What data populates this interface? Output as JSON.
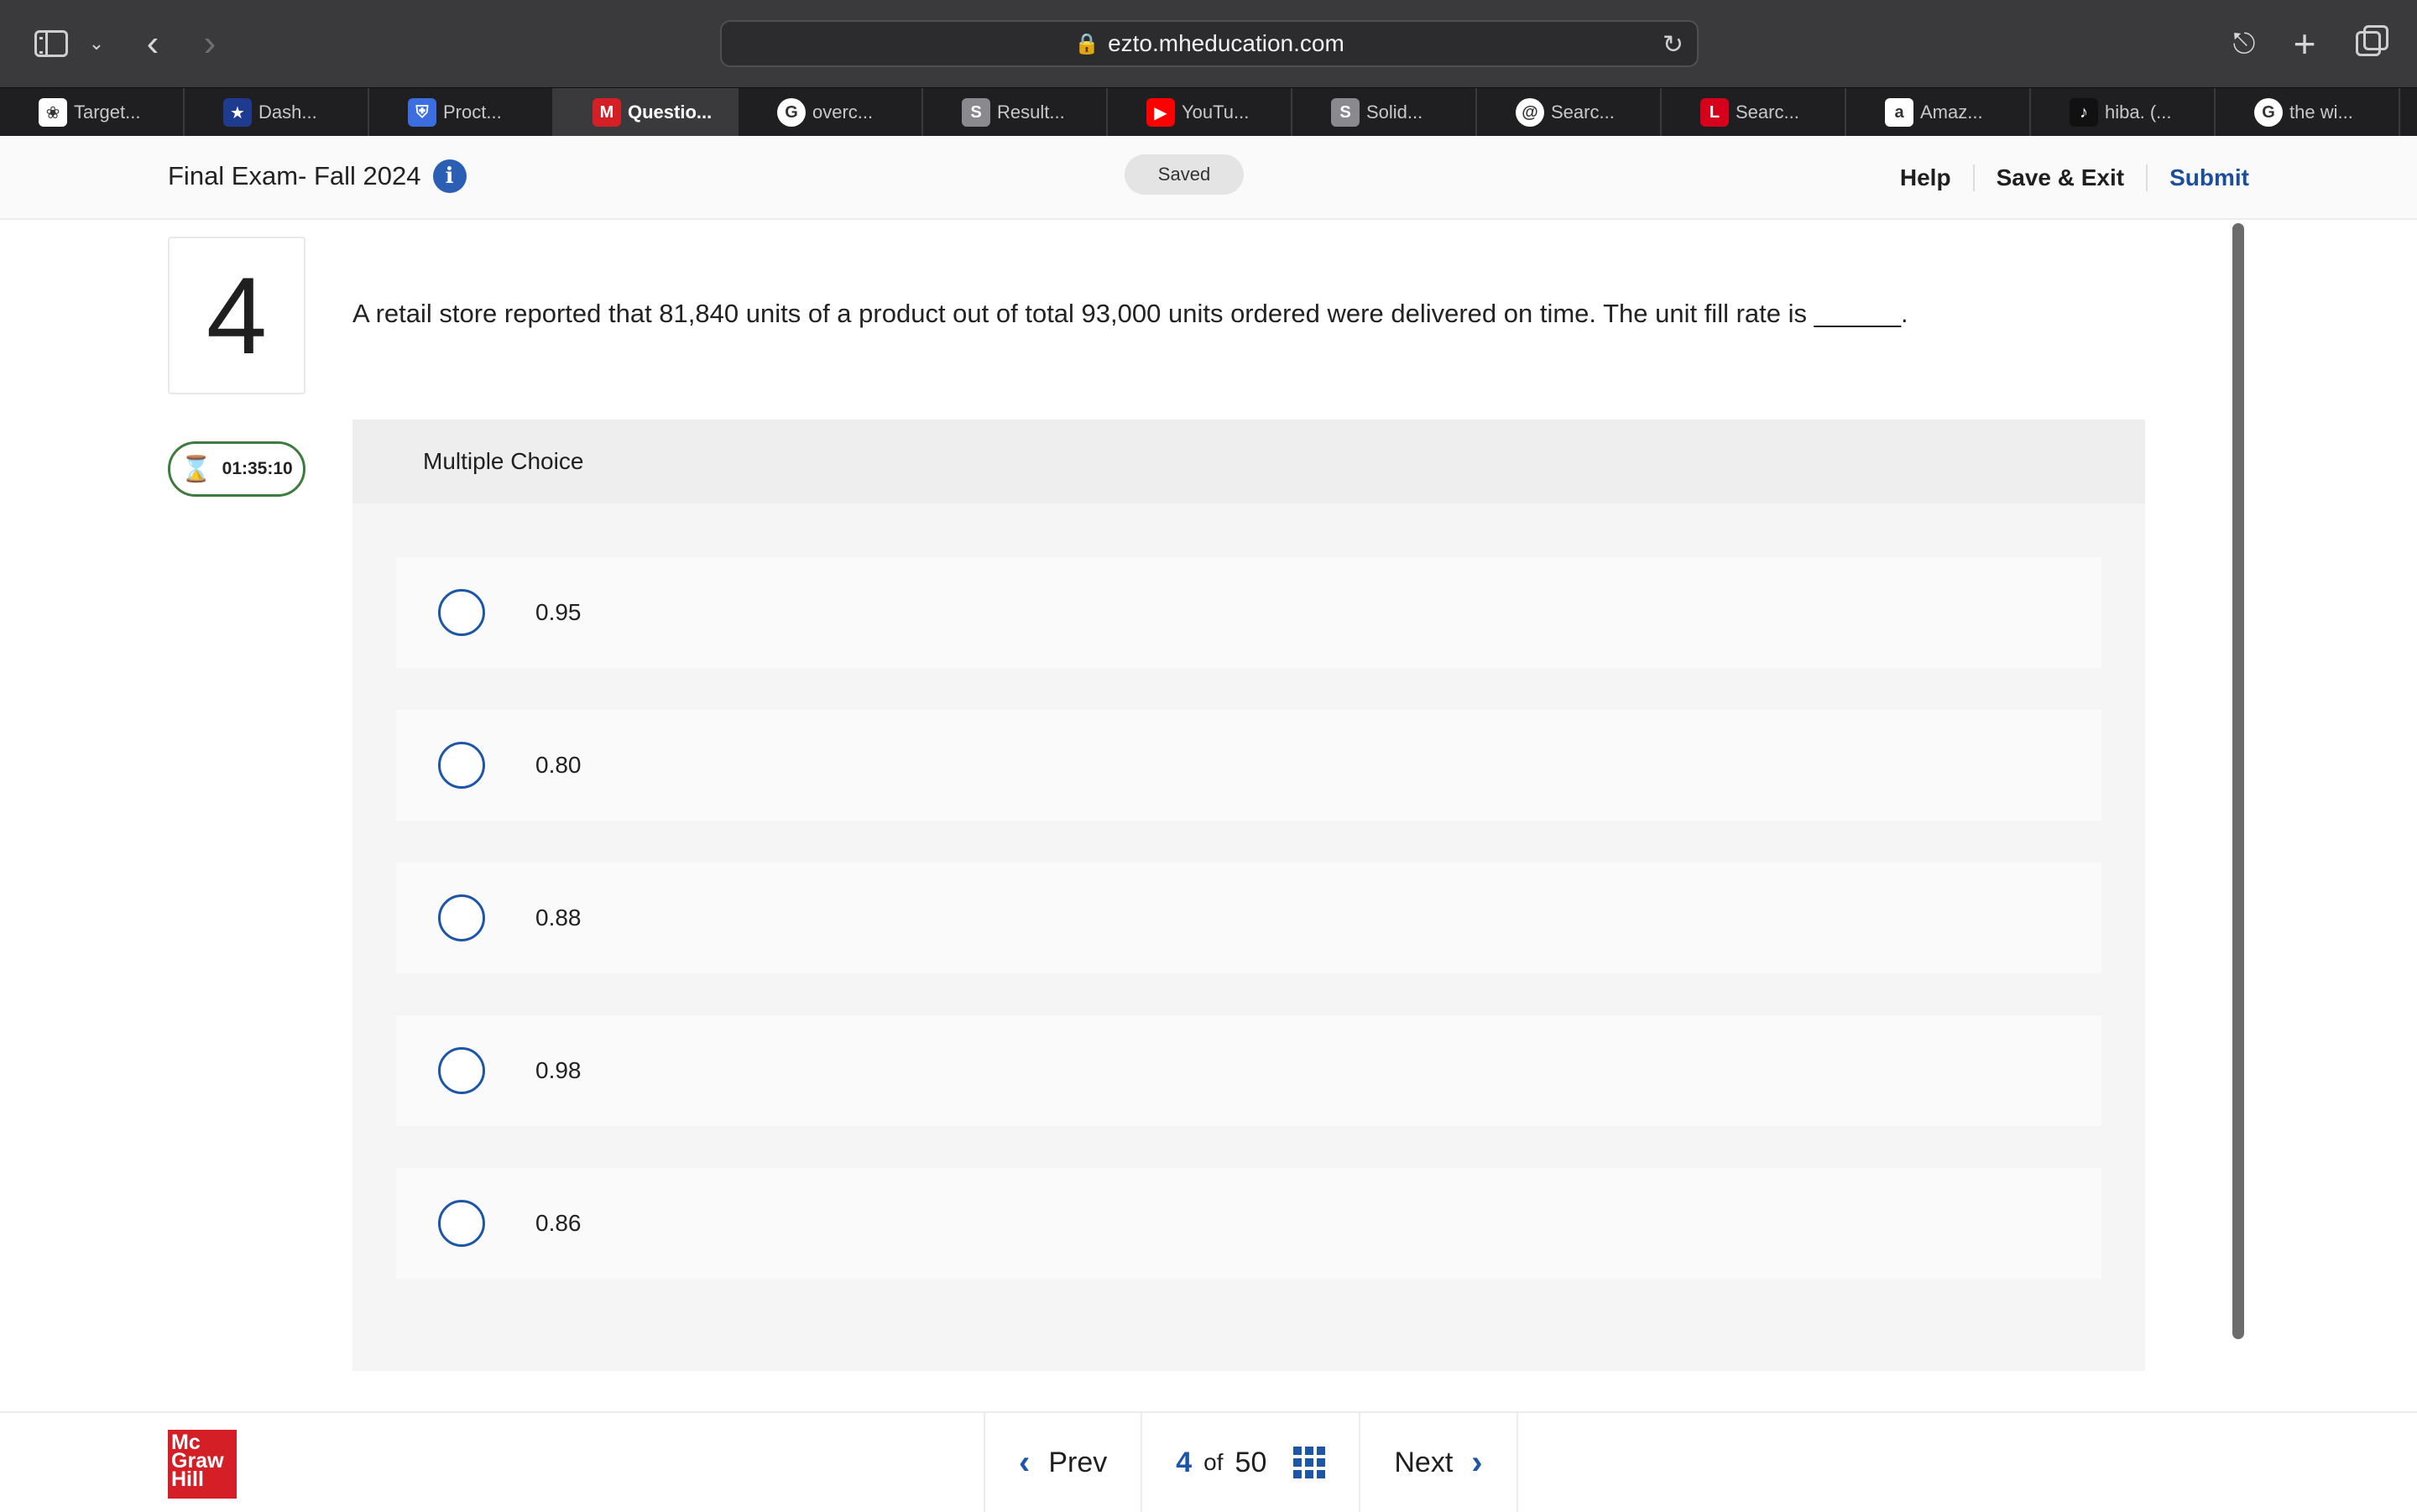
{
  "browser": {
    "url": "ezto.mheducation.com",
    "tabs": [
      {
        "label": "Target...",
        "icon": "openai-icon",
        "color": "#ffffff"
      },
      {
        "label": "Dash...",
        "icon": "star-badge-icon",
        "color": "#1f3b8f"
      },
      {
        "label": "Proct...",
        "icon": "shield-icon",
        "color": "#3d6ee0"
      },
      {
        "label": "Questio...",
        "icon": "mcgraw-m-icon",
        "color": "#d41f26",
        "active": true
      },
      {
        "label": "overc...",
        "icon": "google-icon",
        "color": "#ffffff"
      },
      {
        "label": "Result...",
        "icon": "s-icon",
        "color": "#8a8a8e"
      },
      {
        "label": "YouTu...",
        "icon": "youtube-icon",
        "color": "#ff0000"
      },
      {
        "label": "Solid...",
        "icon": "s-icon",
        "color": "#8a8a8e"
      },
      {
        "label": "Searc...",
        "icon": "at-icon",
        "color": "#ffffff"
      },
      {
        "label": "Searc...",
        "icon": "lego-icon",
        "color": "#d6001c"
      },
      {
        "label": "Amaz...",
        "icon": "amazon-icon",
        "color": "#ffffff"
      },
      {
        "label": "hiba. (...",
        "icon": "tiktok-icon",
        "color": "#111111"
      },
      {
        "label": "the wi...",
        "icon": "google-icon",
        "color": "#ffffff"
      }
    ]
  },
  "exam": {
    "title": "Final Exam- Fall 2024",
    "status": "Saved",
    "help_label": "Help",
    "save_exit_label": "Save & Exit",
    "submit_label": "Submit"
  },
  "question": {
    "number": "4",
    "text": "A retail store reported that 81,840 units of a product out of total 93,000 units ordered were delivered on time. The unit fill rate is ______.",
    "timer": "01:35:10",
    "type_label": "Multiple Choice",
    "choices": [
      "0.95",
      "0.80",
      "0.88",
      "0.98",
      "0.86"
    ]
  },
  "footer": {
    "logo_text": [
      "Mc",
      "Graw",
      "Hill"
    ],
    "prev_label": "Prev",
    "current": "4",
    "of_label": "of",
    "total": "50",
    "next_label": "Next"
  },
  "colors": {
    "accent": "#1d56a8",
    "timer": "#3e7b3e",
    "brand": "#d41f26"
  }
}
